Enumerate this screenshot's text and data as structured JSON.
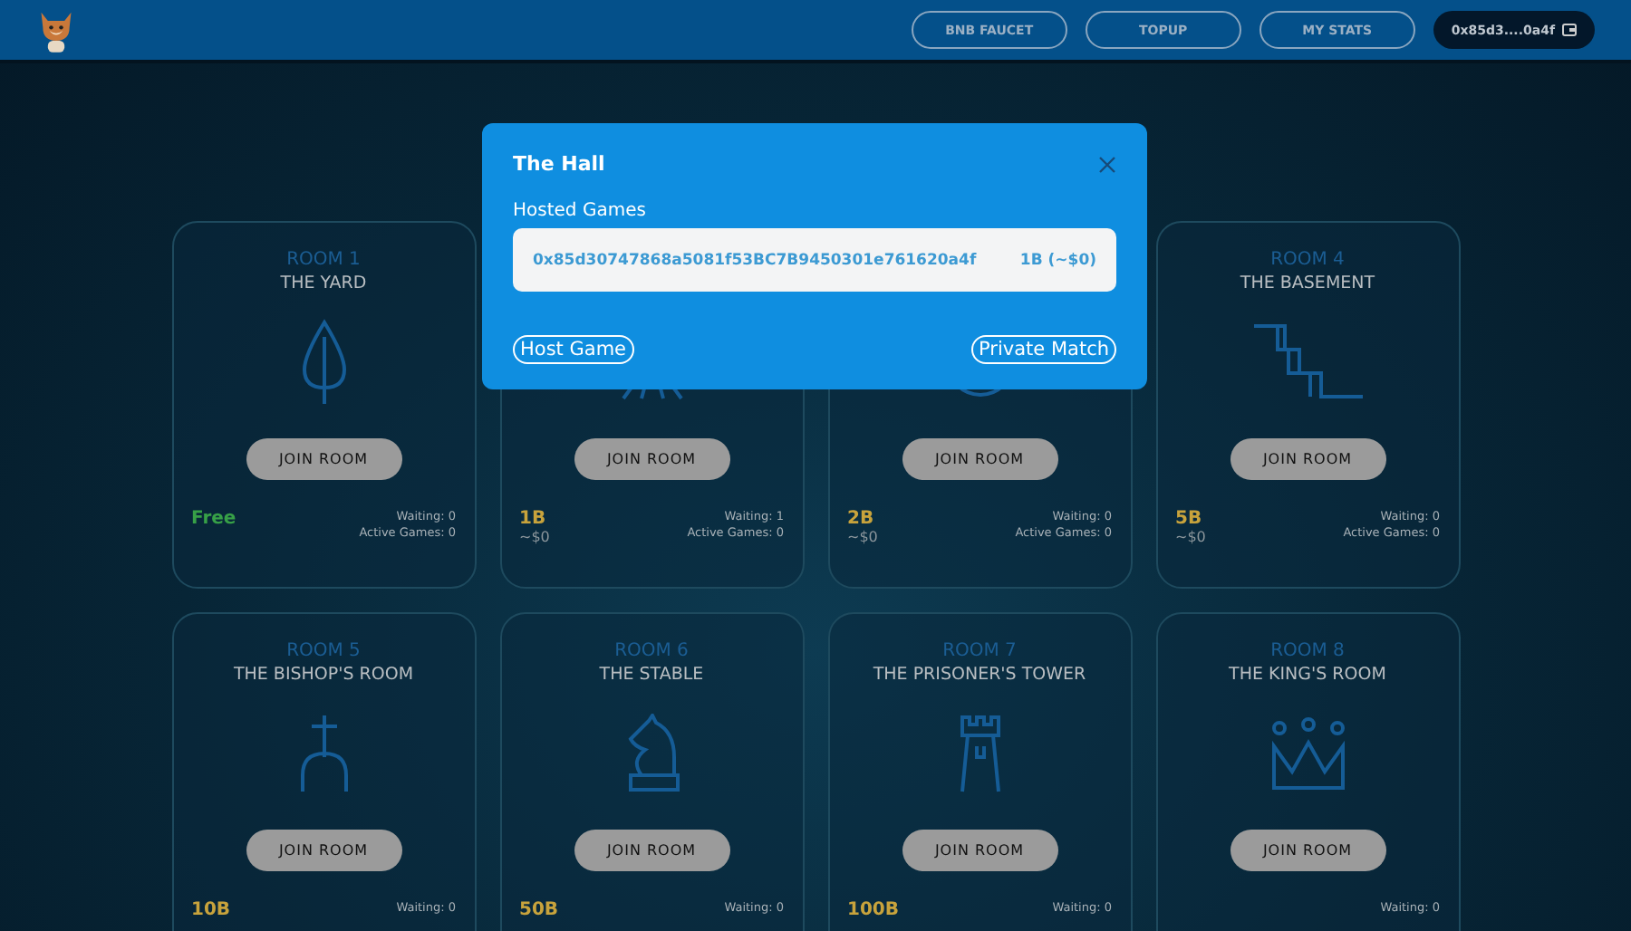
{
  "header": {
    "buttons": [
      "BNB FAUCET",
      "TOPUP",
      "MY STATS"
    ],
    "wallet": "0x85d3....0a4f"
  },
  "rooms": [
    {
      "label": "ROOM 1",
      "name": "THE YARD",
      "price": "Free",
      "color": "#37a047",
      "waiting": "Waiting: 0",
      "active": "Active Games: 0",
      "button": "JOIN ROOM"
    },
    {
      "price": "1B",
      "color": "#c8a33c",
      "usd": "~$0",
      "waiting": "Waiting: 1",
      "active": "Active Games: 0",
      "button": "JOIN ROOM"
    },
    {
      "price": "2B",
      "color": "#c8a33c",
      "usd": "~$0",
      "waiting": "Waiting: 0",
      "active": "Active Games: 0",
      "button": "JOIN ROOM"
    },
    {
      "label": "ROOM 4",
      "name": "THE BASEMENT",
      "price": "5B",
      "color": "#c8a33c",
      "usd": "~$0",
      "waiting": "Waiting: 0",
      "active": "Active Games: 0",
      "button": "JOIN ROOM"
    },
    {
      "label": "ROOM 5",
      "name": "THE BISHOP'S ROOM",
      "price": "10B",
      "color": "#c8a33c",
      "waiting": "Waiting: 0",
      "button": "JOIN ROOM"
    },
    {
      "label": "ROOM 6",
      "name": "THE STABLE",
      "price": "50B",
      "color": "#c8a33c",
      "waiting": "Waiting: 0",
      "button": "JOIN ROOM"
    },
    {
      "label": "ROOM 7",
      "name": "THE PRISONER'S TOWER",
      "price": "100B",
      "color": "#c8a33c",
      "waiting": "Waiting: 0",
      "button": "JOIN ROOM"
    },
    {
      "label": "ROOM 8",
      "name": "THE KING'S ROOM",
      "waiting": "Waiting: 0",
      "button": "JOIN ROOM"
    }
  ],
  "modal": {
    "title": "The Hall",
    "section": "Hosted Games",
    "games": [
      {
        "address": "0x85d30747868a5081f53BC7B9450301e761620a4f",
        "stake": "1B (~$0)"
      }
    ],
    "buttons": [
      "Host Game",
      "Private Match"
    ]
  }
}
